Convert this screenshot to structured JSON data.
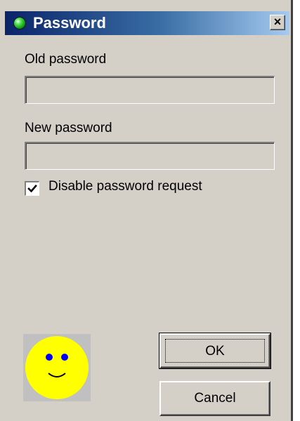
{
  "window": {
    "title": "Password",
    "title_icon": "green-dot-icon",
    "close_label": "×",
    "titlebar_colors": [
      "#0a246a",
      "#a6caf0"
    ],
    "background": "#d4d0c8"
  },
  "form": {
    "old_password": {
      "label": "Old password",
      "value": ""
    },
    "new_password": {
      "label": "New password",
      "value": ""
    },
    "disable_request": {
      "label": "Disable password request",
      "checked": true
    }
  },
  "image": {
    "icon": "smiley-face-icon",
    "face_color": "#ffff00",
    "eye_color": "#0000ff"
  },
  "buttons": {
    "ok_label": "OK",
    "cancel_label": "Cancel"
  }
}
